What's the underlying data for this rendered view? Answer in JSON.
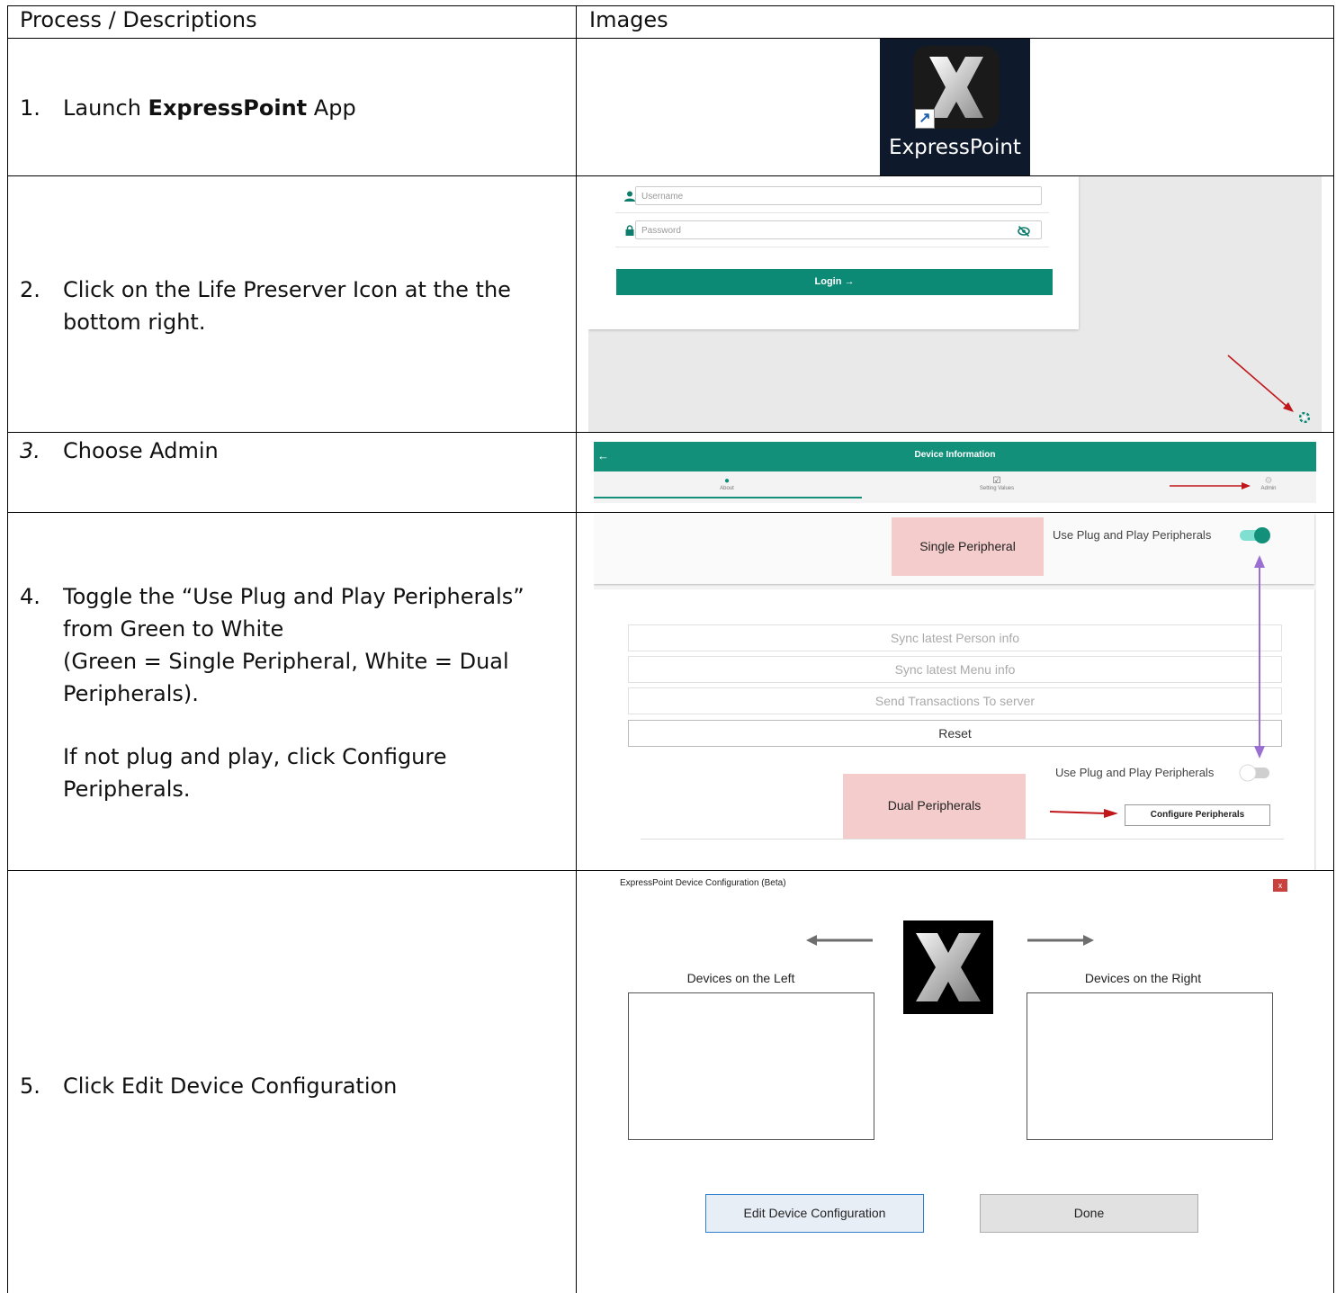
{
  "table": {
    "header_process": "Process / Descriptions",
    "header_images": "Images"
  },
  "steps": [
    {
      "num": "1.",
      "text_before": "Launch ",
      "text_bold": "ExpressPoint",
      "text_after": " App"
    },
    {
      "num": "2.",
      "line1": "Click on the Life Preserver Icon at the the",
      "line2": "bottom right."
    },
    {
      "num": "3.",
      "text": "Choose Admin"
    },
    {
      "num": "4.",
      "line1": "Toggle the “Use Plug and Play Peripherals”",
      "line2": "from Green to White",
      "line3": "(Green = Single Peripheral, White = Dual",
      "line4": "Peripherals).",
      "line5": "If not plug and play, click Configure",
      "line6": "Peripherals."
    },
    {
      "num": "5.",
      "text": "Click Edit Device Configuration"
    }
  ],
  "img1": {
    "app_name": "ExpressPoint",
    "shortcut_glyph": "↗",
    "icon": "expresspoint-x-logo-icon"
  },
  "img2": {
    "username_placeholder": "Username",
    "password_placeholder": "Password",
    "login_label": "Login →",
    "user_icon": "person-icon",
    "lock_icon": "lock-icon",
    "eye_icon": "eye-slash-icon",
    "lifepreserver_icon": "life-preserver-icon",
    "accent": "#0d8a75",
    "arrow_color": "#c0171b"
  },
  "img3": {
    "title": "Device Information",
    "back_glyph": "←",
    "tabs": [
      {
        "label": "About",
        "icon": "info-icon",
        "glyph": "●"
      },
      {
        "label": "Setting Values",
        "icon": "checkbox-icon",
        "glyph": "☑"
      },
      {
        "label": "Admin",
        "icon": "gear-icon",
        "glyph": "⚙"
      }
    ]
  },
  "img4": {
    "single_label": "Single Peripheral",
    "pnp_label_on": "Use Plug and Play Peripherals",
    "toggle_on": true,
    "buttons": [
      "Sync latest Person info",
      "Sync latest Menu info",
      "Send Transactions To server",
      "Reset"
    ],
    "pnp_label_off": "Use Plug and Play Peripherals",
    "toggle_off": false,
    "dual_label": "Dual Peripherals",
    "configure_label": "Configure Peripherals",
    "toggle_color": "#1ec8b0",
    "highlight_color": "#f4cccc",
    "purple_arrow_color": "#9b6fd1"
  },
  "img5": {
    "window_title": "ExpressPoint Device Configuration (Beta)",
    "close_glyph": "x",
    "left_label": "Devices on the Left",
    "right_label": "Devices on the Right",
    "edit_label": "Edit Device Configuration",
    "done_label": "Done"
  }
}
